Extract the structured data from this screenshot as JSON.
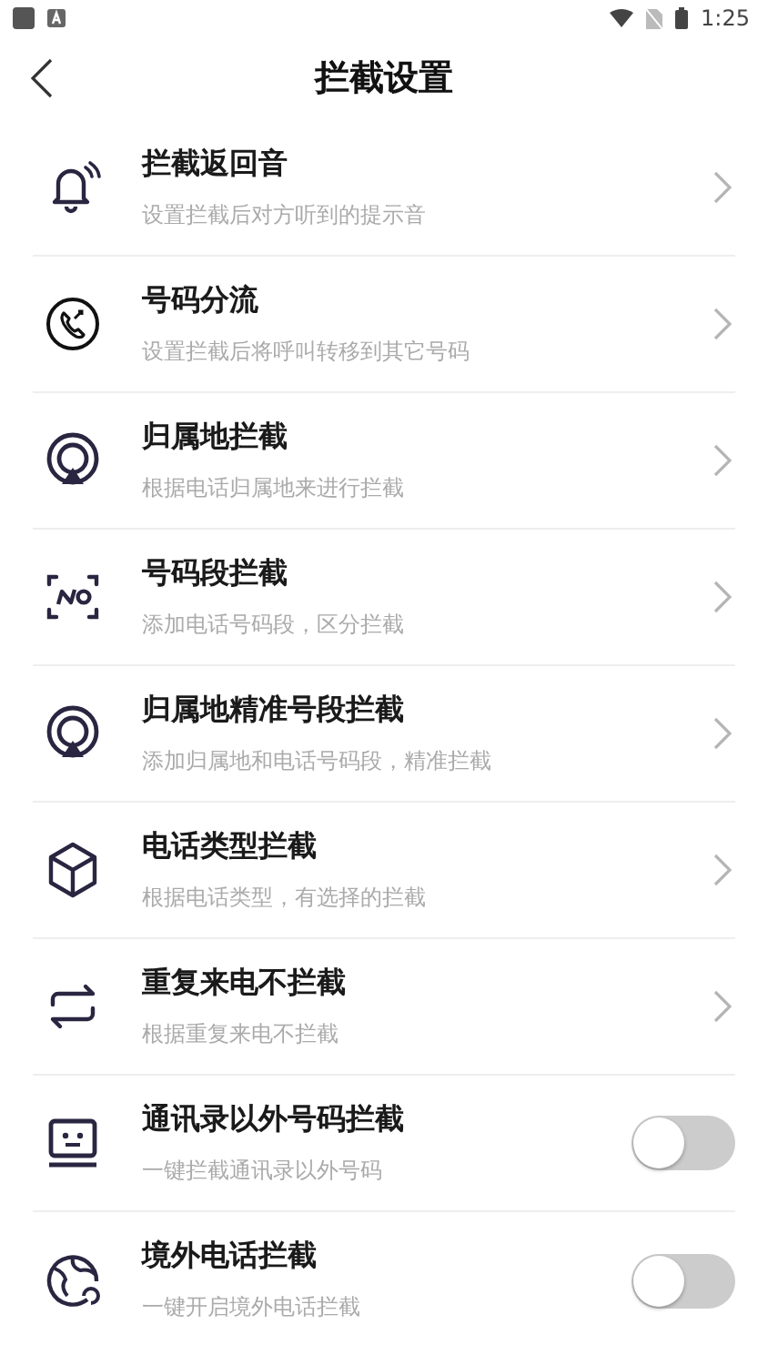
{
  "status_bar": {
    "time": "1:25"
  },
  "header": {
    "title": "拦截设置"
  },
  "items": [
    {
      "kind": "link",
      "title": "拦截返回音",
      "subtitle": "设置拦截后对方听到的提示音"
    },
    {
      "kind": "link",
      "title": "号码分流",
      "subtitle": "设置拦截后将呼叫转移到其它号码"
    },
    {
      "kind": "link",
      "title": "归属地拦截",
      "subtitle": "根据电话归属地来进行拦截"
    },
    {
      "kind": "link",
      "title": "号码段拦截",
      "subtitle": "添加电话号码段，区分拦截"
    },
    {
      "kind": "link",
      "title": "归属地精准号段拦截",
      "subtitle": "添加归属地和电话号码段，精准拦截"
    },
    {
      "kind": "link",
      "title": "电话类型拦截",
      "subtitle": "根据电话类型，有选择的拦截"
    },
    {
      "kind": "link",
      "title": "重复来电不拦截",
      "subtitle": "根据重复来电不拦截"
    },
    {
      "kind": "toggle",
      "title": "通讯录以外号码拦截",
      "subtitle": "一键拦截通讯录以外号码",
      "on": false
    },
    {
      "kind": "toggle",
      "title": "境外电话拦截",
      "subtitle": "一键开启境外电话拦截",
      "on": false
    }
  ]
}
